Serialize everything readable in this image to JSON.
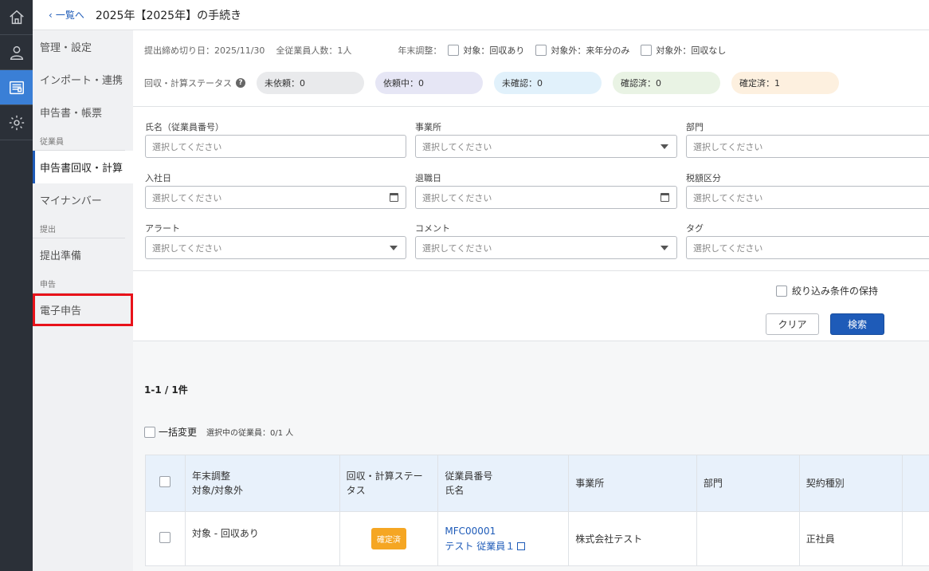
{
  "rail": {
    "items": [
      {
        "icon": "home-icon",
        "active": false
      },
      {
        "icon": "person-icon",
        "active": false
      },
      {
        "icon": "document-icon",
        "active": true
      },
      {
        "icon": "gear-icon",
        "active": false
      }
    ]
  },
  "header": {
    "back_label": "一覧へ",
    "title": "2025年【2025年】の手続き"
  },
  "subnav": {
    "items": [
      {
        "label": "管理・設定"
      },
      {
        "label": "インポート・連携"
      },
      {
        "label": "申告書・帳票"
      }
    ],
    "section_employee": "従業員",
    "employee_items": [
      {
        "label": "申告書回収・計算"
      },
      {
        "label": "マイナンバー"
      }
    ],
    "section_submit": "提出",
    "submit_items": [
      {
        "label": "提出準備"
      }
    ],
    "section_filing": "申告",
    "filing_items": [
      {
        "label": "電子申告"
      }
    ]
  },
  "summary": {
    "deadline": "提出締め切り日：2025/11/30",
    "employee_count": "全従業員人数：1人",
    "yearend_label": "年末調整：",
    "opt1": "対象：回収あり",
    "opt2": "対象外：来年分のみ",
    "opt3": "対象外：回収なし",
    "status_label": "回収・計算ステータス",
    "help": "?",
    "statuses": [
      {
        "label": "未依頼：0",
        "color": "#e9eaec"
      },
      {
        "label": "依頼中：0",
        "color": "#e6e6f5"
      },
      {
        "label": "未確認：0",
        "color": "#e1f1fb"
      },
      {
        "label": "確認済：0",
        "color": "#e9f3e4"
      },
      {
        "label": "確定済：1",
        "color": "#fdf0df"
      }
    ]
  },
  "filters": {
    "name_label": "氏名（従業員番号）",
    "office_label": "事業所",
    "dept_label": "部門",
    "hire_label": "入社日",
    "retire_label": "退職日",
    "tax_label": "税額区分",
    "alert_label": "アラート",
    "comment_label": "コメント",
    "tag_label": "タグ",
    "placeholder": "選択してください"
  },
  "actions": {
    "keep_filter": "絞り込み条件の保持",
    "clear": "クリア",
    "search": "検索"
  },
  "results": {
    "count": "1-1 / 1件",
    "bulk_label": "一括変更",
    "selected": "選択中の従業員：0/1 人",
    "columns": {
      "yearend": [
        "年末調整",
        "対象/対象外"
      ],
      "status": [
        "回収・計算ステー",
        "タス"
      ],
      "emp": [
        "従業員番号",
        "氏名"
      ],
      "office": "事業所",
      "dept": "部門",
      "contract": "契約種別"
    },
    "rows": [
      {
        "yearend": "対象 - 回収あり",
        "status": "確定済",
        "emp_no": "MFC00001",
        "emp_name": "テスト 従業員１",
        "office": "株式会社テスト",
        "dept": "",
        "contract": "正社員"
      }
    ]
  }
}
